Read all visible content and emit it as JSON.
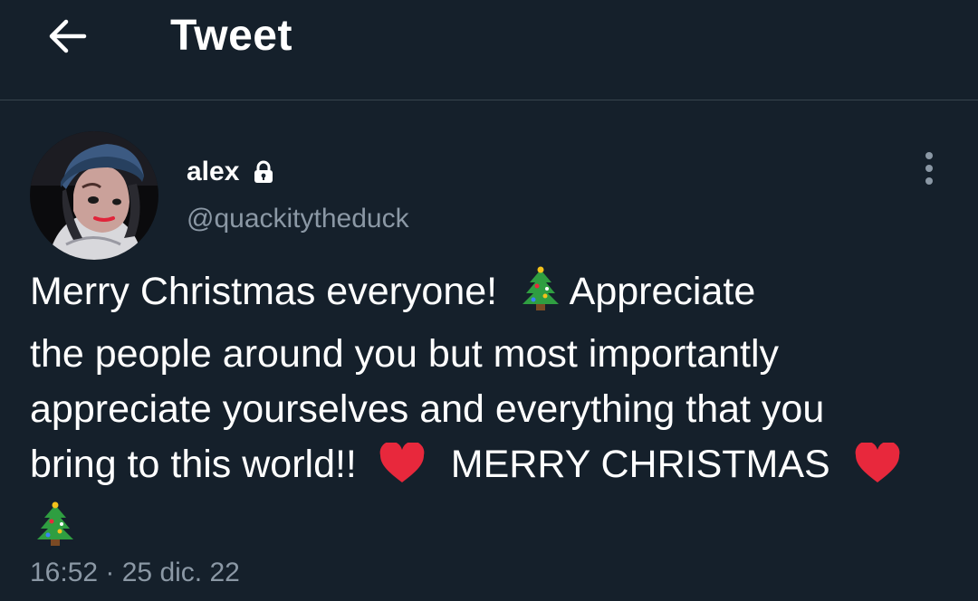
{
  "header": {
    "back_icon": "arrow-left-icon",
    "title": "Tweet"
  },
  "tweet": {
    "author": {
      "name": "alex",
      "handle": "@quackitytheduck",
      "protected_icon": "lock-icon"
    },
    "more_icon": "more-vertical-icon",
    "text_lines": [
      "Merry Christmas everyone!",
      "Appreciate",
      "the people around you but most importantly",
      "appreciate yourselves and everything that you",
      "bring to this world!!",
      "MERRY CHRISTMAS"
    ],
    "emojis": [
      "christmas-tree-icon",
      "red-heart-icon"
    ],
    "timestamp": "16:52 · 25 dic. 22"
  },
  "colors": {
    "background": "#15202b",
    "text": "#ffffff",
    "secondary_text": "#8b98a5",
    "divider": "#38444d",
    "heart": "#e8283c",
    "tree": "#2f9e41"
  }
}
